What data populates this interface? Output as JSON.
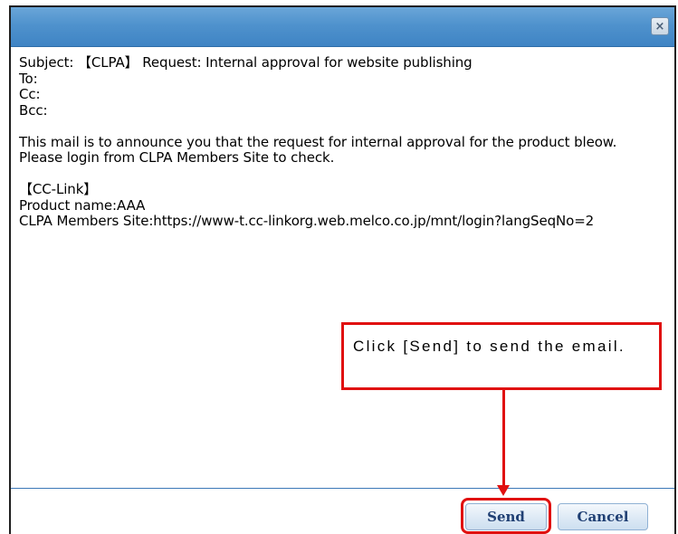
{
  "dialog": {
    "close_symbol": "×",
    "email": {
      "subject_line": "Subject: 【CLPA】 Request: Internal approval for website publishing",
      "to_line": "To:",
      "cc_line": "Cc:",
      "bcc_line": "Bcc:",
      "paragraph1": "This mail is to announce you that the request for internal approval for the product bleow.",
      "paragraph2": "Please login from CLPA Members Site to check.",
      "section_header": "【CC-Link】",
      "product_line": "Product name:AAA",
      "site_line": "CLPA Members Site:https://www-t.cc-linkorg.web.melco.co.jp/mnt/login?langSeqNo=2"
    },
    "buttons": {
      "send_label": "Send",
      "cancel_label": "Cancel"
    }
  },
  "annotation": {
    "callout_text": "Click [Send] to send the email."
  },
  "colors": {
    "titlebar": "#4f92cd",
    "highlight": "#e01010",
    "button_text": "#1f3f73"
  }
}
